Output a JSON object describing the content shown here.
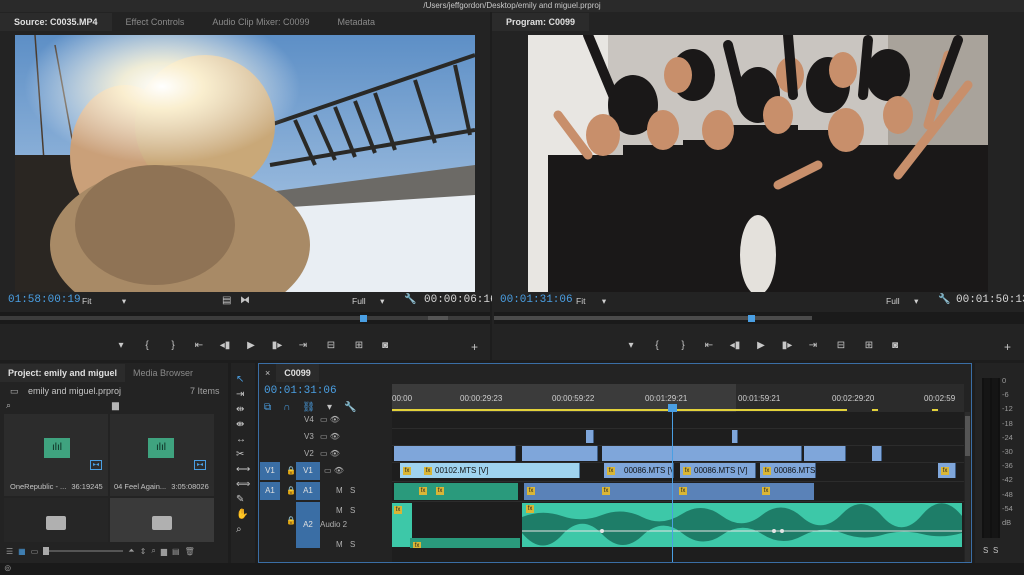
{
  "window": {
    "title": "/Users/jeffgordon/Desktop/emily and miguel.prproj"
  },
  "source_panel": {
    "tabs": [
      "Source: C0035.MP4",
      "Effect Controls",
      "Audio Clip Mixer: C0099",
      "Metadata"
    ],
    "timecode": "01:58:00:19",
    "fit": "Fit",
    "resolution": "Full",
    "duration": "00:00:06:16"
  },
  "program_panel": {
    "tab": "Program: C0099",
    "timecode": "00:01:31:06",
    "fit": "Fit",
    "resolution": "Full",
    "duration": "00:01:50:13"
  },
  "project_panel": {
    "tabs": [
      "Project: emily and miguel",
      "Media Browser"
    ],
    "file": "emily and miguel.prproj",
    "items_count": "7 Items",
    "items": [
      {
        "name": "OneRepublic - ...",
        "duration": "36:19245"
      },
      {
        "name": "04 Feel Again...",
        "duration": "3:05:08026"
      }
    ]
  },
  "timeline": {
    "tab": "C0099",
    "timecode": "00:01:31:06",
    "ruler": [
      "00:00",
      "00:00:29:23",
      "00:00:59:22",
      "00:01:29:21",
      "00:01:59:21",
      "00:02:29:20",
      "00:02:59"
    ],
    "tracks": {
      "v4": "V4",
      "v3": "V3",
      "v2": "V2",
      "v1": "V1",
      "v1_src": "V1",
      "a1": "A1",
      "a1_src": "A1",
      "a2": "A2",
      "a2_name": "Audio 2",
      "m": "M",
      "s": "S"
    },
    "clips": {
      "c1": "00102.MTS [V]",
      "c2": "00086.MTS [V]",
      "c3": "00086.MTS [V]",
      "c4": "00086.MTS"
    },
    "fx": "fx"
  },
  "meter": {
    "labels": [
      "0",
      "-6",
      "-12",
      "-18",
      "-24",
      "-30",
      "-36",
      "-42",
      "-48",
      "-54",
      "dB"
    ],
    "solo": "S"
  }
}
